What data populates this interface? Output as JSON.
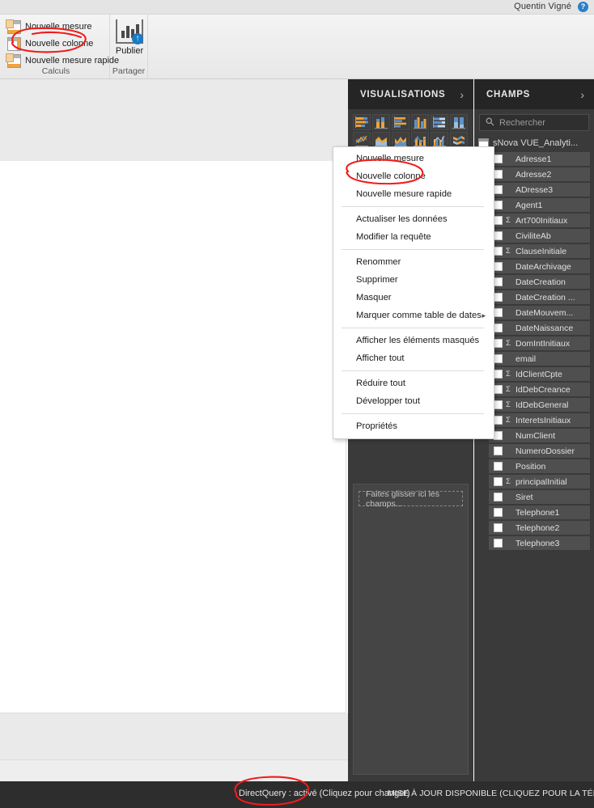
{
  "titlebar": {
    "account_name": "Quentin Vigné",
    "help_icon": "help-icon",
    "help_glyph": "?"
  },
  "ribbon": {
    "groups": [
      {
        "name": "calculs",
        "label": "Calculs"
      },
      {
        "name": "partager",
        "label": "Partager"
      }
    ],
    "buttons": {
      "nouvelle_mesure": "Nouvelle mesure",
      "nouvelle_colonne": "Nouvelle colonne",
      "nouvelle_mesure_rapide": "Nouvelle mesure rapide",
      "publier": "Publier"
    }
  },
  "context_menu": {
    "items": [
      {
        "label": "Nouvelle mesure",
        "submenu": false,
        "separator_after": false
      },
      {
        "label": "Nouvelle colonne",
        "submenu": false,
        "separator_after": false
      },
      {
        "label": "Nouvelle mesure rapide",
        "submenu": false,
        "separator_after": true
      },
      {
        "label": "Actualiser les données",
        "submenu": false,
        "separator_after": false
      },
      {
        "label": "Modifier la requête",
        "submenu": false,
        "separator_after": true
      },
      {
        "label": "Renommer",
        "submenu": false,
        "separator_after": false
      },
      {
        "label": "Supprimer",
        "submenu": false,
        "separator_after": false
      },
      {
        "label": "Masquer",
        "submenu": false,
        "separator_after": false
      },
      {
        "label": "Marquer comme table de dates",
        "submenu": true,
        "separator_after": true
      },
      {
        "label": "Afficher les éléments masqués",
        "submenu": false,
        "separator_after": false
      },
      {
        "label": "Afficher tout",
        "submenu": false,
        "separator_after": true
      },
      {
        "label": "Réduire tout",
        "submenu": false,
        "separator_after": false
      },
      {
        "label": "Développer tout",
        "submenu": false,
        "separator_after": true
      },
      {
        "label": "Propriétés",
        "submenu": false,
        "separator_after": false
      }
    ]
  },
  "visualizations_panel": {
    "title": "VISUALISATIONS",
    "chevron": "›",
    "gallery_icons": [
      "stacked-bar-chart-icon",
      "stacked-column-chart-icon",
      "clustered-bar-chart-icon",
      "clustered-column-chart-icon",
      "hundred-percent-stacked-bar-chart-icon",
      "hundred-percent-stacked-column-chart-icon",
      "line-chart-icon",
      "area-chart-icon",
      "stacked-area-chart-icon",
      "line-stacked-column-chart-icon",
      "line-clustered-column-chart-icon",
      "ribbon-chart-icon"
    ],
    "dropzone_placeholder": "Faites glisser ici les champs..."
  },
  "fields_panel": {
    "title": "CHAMPS",
    "chevron": "›",
    "search_placeholder": "Rechercher",
    "search_value": "",
    "table_name": "sNova VUE_Analyti...",
    "fields": [
      {
        "label": "Adresse1",
        "aggregate": false
      },
      {
        "label": "Adresse2",
        "aggregate": false
      },
      {
        "label": "ADresse3",
        "aggregate": false
      },
      {
        "label": "Agent1",
        "aggregate": false
      },
      {
        "label": "Art700Initiaux",
        "aggregate": true
      },
      {
        "label": "CiviliteAb",
        "aggregate": false
      },
      {
        "label": "ClauseInitiale",
        "aggregate": true
      },
      {
        "label": "DateArchivage",
        "aggregate": false
      },
      {
        "label": "DateCreation",
        "aggregate": false
      },
      {
        "label": "DateCreation ...",
        "aggregate": false
      },
      {
        "label": "DateMouvem...",
        "aggregate": false
      },
      {
        "label": "DateNaissance",
        "aggregate": false
      },
      {
        "label": "DomIntInitiaux",
        "aggregate": true
      },
      {
        "label": "email",
        "aggregate": false
      },
      {
        "label": "IdClientCpte",
        "aggregate": true
      },
      {
        "label": "IdDebCreance",
        "aggregate": true
      },
      {
        "label": "IdDebGeneral",
        "aggregate": true
      },
      {
        "label": "InteretsInitiaux",
        "aggregate": true
      },
      {
        "label": "NumClient",
        "aggregate": false
      },
      {
        "label": "NumeroDossier",
        "aggregate": false
      },
      {
        "label": "Position",
        "aggregate": false
      },
      {
        "label": "principalInitial",
        "aggregate": true
      },
      {
        "label": "Siret",
        "aggregate": false
      },
      {
        "label": "Telephone1",
        "aggregate": false
      },
      {
        "label": "Telephone2",
        "aggregate": false
      },
      {
        "label": "Telephone3",
        "aggregate": false
      }
    ]
  },
  "status_bar": {
    "directquery": "DirectQuery : activé (Cliquez pour changer)",
    "update": "MISE À JOUR DISPONIBLE (CLIQUEZ POUR LA TÉLÉCHARGER)"
  },
  "annotations": {
    "color": "#ee1c1c",
    "marks": [
      "ribbon-nouvelle-colonne-circle",
      "menu-nouvelle-colonne-circle",
      "status-directquery-circle"
    ]
  }
}
